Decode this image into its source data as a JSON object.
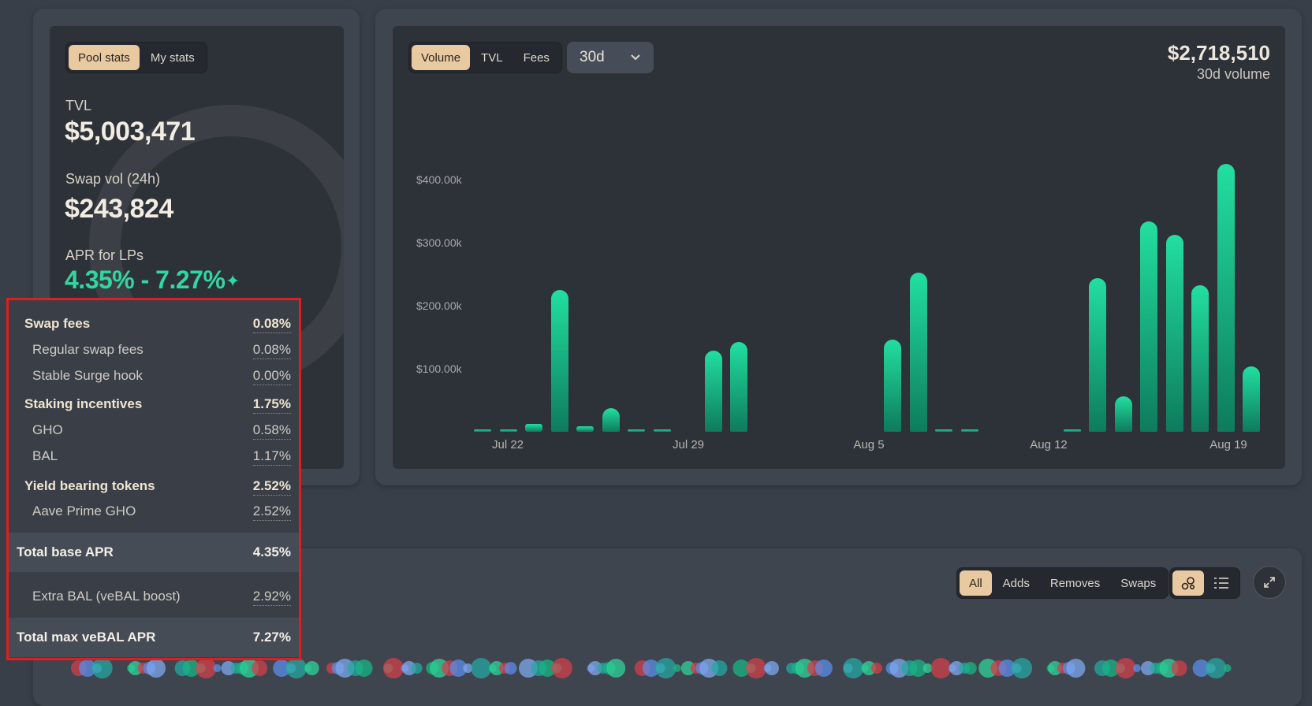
{
  "stats_panel": {
    "tabs": [
      {
        "label": "Pool stats",
        "active": true
      },
      {
        "label": "My stats",
        "active": false
      }
    ],
    "tvl_label": "TVL",
    "tvl_value": "$5,003,471",
    "swap_vol_label": "Swap vol (24h)",
    "swap_vol_value": "$243,824",
    "apr_label": "APR for LPs",
    "apr_value": "4.35% - 7.27%",
    "apr_icon": "sparkles-icon"
  },
  "apr_tooltip": {
    "sections": [
      {
        "label": "Swap fees",
        "value": "0.08%",
        "items": [
          {
            "label": "Regular swap fees",
            "value": "0.08%"
          },
          {
            "label": "Stable Surge hook",
            "value": "0.00%"
          }
        ]
      },
      {
        "label": "Staking incentives",
        "value": "1.75%",
        "items": [
          {
            "label": "GHO",
            "value": "0.58%"
          },
          {
            "label": "BAL",
            "value": "1.17%"
          }
        ]
      },
      {
        "label": "Yield bearing tokens",
        "value": "2.52%",
        "items": [
          {
            "label": "Aave Prime GHO",
            "value": "2.52%"
          }
        ]
      }
    ],
    "total_base_label": "Total base APR",
    "total_base_value": "4.35%",
    "extra_label": "Extra BAL (veBAL boost)",
    "extra_value": "2.92%",
    "total_max_label": "Total max veBAL APR",
    "total_max_value": "7.27%",
    "highlight_color": "#e01e1e"
  },
  "chart_panel": {
    "tabs": [
      {
        "label": "Volume",
        "active": true
      },
      {
        "label": "TVL",
        "active": false
      },
      {
        "label": "Fees",
        "active": false
      }
    ],
    "period": "30d",
    "summary_value": "$2,718,510",
    "summary_label": "30d volume"
  },
  "chart_data": {
    "type": "bar",
    "x_tick_labels": [
      "Jul 22",
      "Jul 29",
      "Aug 5",
      "Aug 12",
      "Aug 19"
    ],
    "y_tick_labels": [
      "$400.00k",
      "$300.00k",
      "$200.00k",
      "$100.00k"
    ],
    "ylim": [
      0,
      430000
    ],
    "values": [
      1000,
      4000,
      12000,
      225000,
      9000,
      37000,
      3000,
      500,
      0,
      0,
      0,
      0,
      0,
      0,
      0,
      0,
      0,
      0,
      0,
      0,
      0,
      0,
      0,
      0,
      0,
      0,
      0,
      0,
      0,
      0,
      0,
      0,
      0,
      0,
      0,
      0,
      0,
      0,
      0,
      0,
      0,
      0,
      0,
      0,
      0,
      0,
      0,
      0,
      0,
      0,
      0,
      0,
      0,
      0,
      0,
      0,
      0,
      0,
      0,
      0,
      0,
      0,
      0,
      0,
      0,
      0,
      0,
      0,
      0,
      0,
      0,
      0,
      0,
      0,
      0,
      0,
      0,
      0,
      0,
      0,
      0,
      0,
      0,
      0,
      0,
      0,
      0,
      0,
      0,
      0,
      0,
      0,
      0,
      0,
      0,
      0,
      0,
      0,
      0,
      0,
      0,
      0,
      0,
      0
    ],
    "bars": [
      {
        "date": "Jul 21",
        "value": 1000
      },
      {
        "date": "Jul 22",
        "value": 4000
      },
      {
        "date": "Jul 23",
        "value": 12000
      },
      {
        "date": "Jul 24",
        "value": 225000
      },
      {
        "date": "Jul 25",
        "value": 9000
      },
      {
        "date": "Jul 26",
        "value": 37000
      },
      {
        "date": "Jul 27",
        "value": 3000
      },
      {
        "date": "Jul 28",
        "value": 500
      },
      {
        "date": "Jul 29",
        "value": 0
      },
      {
        "date": "Jul 30",
        "value": 129000
      },
      {
        "date": "Jul 31",
        "value": 142000
      },
      {
        "date": "Aug 1",
        "value": 0
      },
      {
        "date": "Aug 2",
        "value": 0
      },
      {
        "date": "Aug 3",
        "value": 0
      },
      {
        "date": "Aug 4",
        "value": 0
      },
      {
        "date": "Aug 5",
        "value": 0
      },
      {
        "date": "Aug 6",
        "value": 146000
      },
      {
        "date": "Aug 7",
        "value": 252000
      },
      {
        "date": "Aug 8",
        "value": 500
      },
      {
        "date": "Aug 9",
        "value": 500
      },
      {
        "date": "Aug 10",
        "value": 0
      },
      {
        "date": "Aug 11",
        "value": 0
      },
      {
        "date": "Aug 12",
        "value": 0
      },
      {
        "date": "Aug 13",
        "value": 3000
      },
      {
        "date": "Aug 14",
        "value": 244000
      },
      {
        "date": "Aug 15",
        "value": 56000
      },
      {
        "date": "Aug 16",
        "value": 334000
      },
      {
        "date": "Aug 17",
        "value": 312000
      },
      {
        "date": "Aug 18",
        "value": 232000
      },
      {
        "date": "Aug 19",
        "value": 425000
      },
      {
        "date": "Aug 20",
        "value": 104000
      }
    ],
    "bar_color": "#22dfa0"
  },
  "activity_panel": {
    "filters": [
      {
        "label": "All",
        "active": true
      },
      {
        "label": "Adds",
        "active": false
      },
      {
        "label": "Removes",
        "active": false
      },
      {
        "label": "Swaps",
        "active": false
      }
    ],
    "view_icons": [
      "bubbles-icon",
      "list-icon"
    ],
    "expand_icon": "expand-icon"
  }
}
